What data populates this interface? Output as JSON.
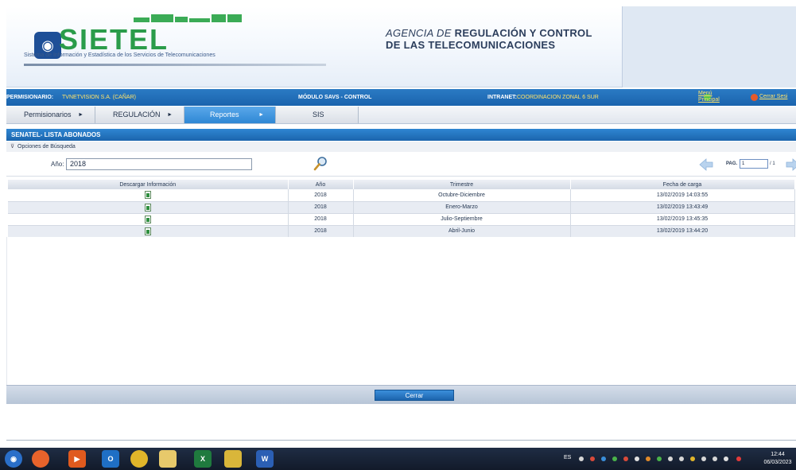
{
  "header": {
    "logo_text": "SIETEL",
    "logo_tagline": "Sistema de Información y Estadística de los Servicios de Telecomunicaciones",
    "agency_line1_light": "AGENCIA DE ",
    "agency_line1_bold": "REGULACIÓN Y CONTROL",
    "agency_line2_bold": "DE LAS TELECOMUNICACIONES"
  },
  "infobar": {
    "permisionario_label": "PERMISIONARIO:",
    "permisionario_value": "TVNETVISION S.A. (CAÑAR)",
    "modulo": "MÓDULO SAVS - CONTROL",
    "intranet_label": "INTRANET:",
    "intranet_value": "COORDINACION ZONAL 6 SUR",
    "menu_principal": "Menú Principal",
    "cerrar_sesion": "Cerrar Sesi"
  },
  "nav": {
    "tabs": [
      {
        "label": "Permisionarios",
        "arrow": "►"
      },
      {
        "label": "REGULACIÓN",
        "arrow": "►"
      },
      {
        "label": "Reportes",
        "arrow": "►"
      },
      {
        "label": "SIS",
        "arrow": ""
      }
    ]
  },
  "section": {
    "title": "SENATEL- LISTA  ABONADOS"
  },
  "search": {
    "header": "Opciones de Búsqueda",
    "anio_label": "Año:",
    "anio_value": "2018",
    "pag_label": "PAG.",
    "pag_value": "1",
    "pag_total": "/ 1"
  },
  "table": {
    "columns": [
      "Descargar Información",
      "Año",
      "Trimestre",
      "Fecha de carga"
    ],
    "rows": [
      {
        "anio": "2018",
        "trimestre": "Octubre-Diciembre",
        "fecha": "13/02/2019 14:03:55"
      },
      {
        "anio": "2018",
        "trimestre": "Enero-Marzo",
        "fecha": "13/02/2019 13:43:49"
      },
      {
        "anio": "2018",
        "trimestre": "Julio-Septiembre",
        "fecha": "13/02/2019 13:45:35"
      },
      {
        "anio": "2018",
        "trimestre": "Abril-Junio",
        "fecha": "13/02/2019 13:44:20"
      }
    ]
  },
  "footer": {
    "cerrar_label": "Cerrar"
  },
  "taskbar": {
    "lang": "ES",
    "time": "12:44",
    "date": "06/03/2023"
  },
  "colors": {
    "primary_blue": "#1a63ad",
    "logo_green": "#2a9c4a",
    "highlight_yellow": "#ffe36a"
  }
}
